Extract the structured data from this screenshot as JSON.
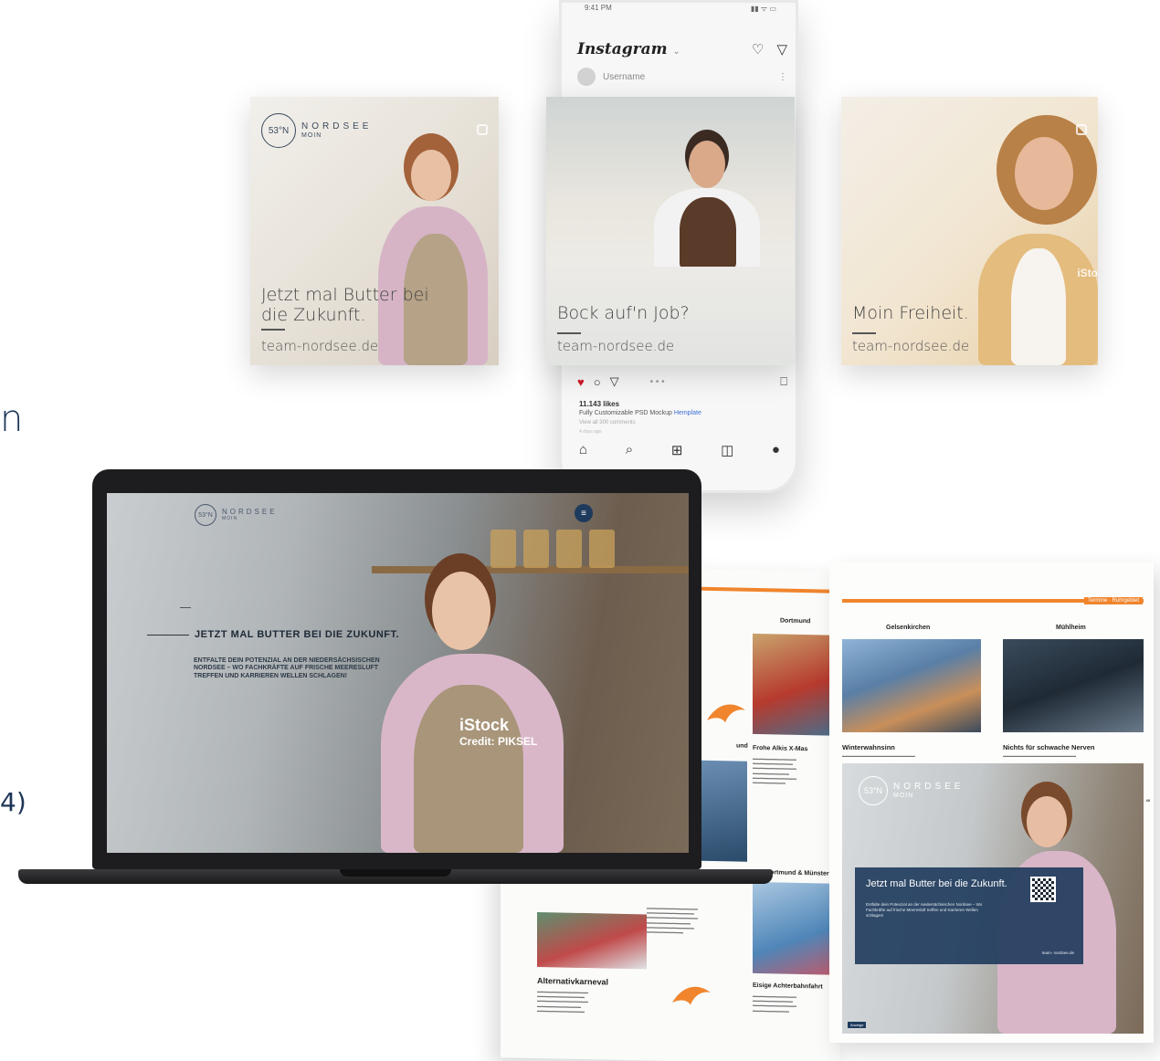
{
  "edge": {
    "n": "n",
    "four": "4)"
  },
  "phone": {
    "status_time": "9:41 PM",
    "status_icons": "▮▮ ᯤ ▭",
    "app_name": "Instagram",
    "username": "Username",
    "likes": "11.143 likes",
    "caption_text": "Fully Customizable PSD Mockup ",
    "caption_link": "Hemplate",
    "comments": "View all 300 comments",
    "time_ago": "4 days ago",
    "icons": {
      "heart": "heart-icon",
      "send": "send-icon",
      "like": "heart-filled-icon",
      "comment": "comment-icon",
      "bookmark": "bookmark-icon",
      "home": "home-icon",
      "search": "search-icon",
      "add": "add-icon",
      "shop": "shop-icon",
      "profile": "profile-icon"
    }
  },
  "brand": {
    "circle": "53°N",
    "word1": "NORDSEE",
    "word2": "MOIN"
  },
  "tiles": [
    {
      "headline_1": "Jetzt mal Butter bei",
      "headline_2": "die Zukunft.",
      "url": "team-nordsee.de"
    },
    {
      "headline_1": "Bock auf'n Job?",
      "url": "team-nordsee.de"
    },
    {
      "headline_1": "Moin Freiheit.",
      "url": "team-nordsee.de",
      "side_text": "iSto"
    }
  ],
  "website": {
    "headline": "JETZT MAL BUTTER BEI DIE ZUKUNFT.",
    "subline": "ENTFALTE DEIN POTENZIAL AN DER NIEDERSÄCHSISCHEN NORDSEE – WO FACHKRÄFTE AUF FRISCHE MEERESLUFT TREFFEN UND KARRIEREN WELLEN SCHLAGEN!",
    "menu_icon": "≡",
    "istock": "iStock",
    "credit": "Credit: PIKSEL"
  },
  "magazine": {
    "left": {
      "city_1": "Dortmund",
      "fragment": "und",
      "heading_1": "Frohe Alkis X-Mas",
      "city_2": "Dortmund & Münster",
      "heading_2": "Alternativkarneval",
      "heading_3": "Eisige Achterbahnfahrt"
    },
    "right": {
      "tag": "Termine · Ruhrgebiet",
      "city_1": "Gelsenkirchen",
      "city_2": "Mühlheim",
      "heading_1": "Winterwahnsinn",
      "heading_2": "Nichts für schwache Nerven",
      "page_number": "49",
      "ad_title": "Jetzt mal Butter bei die Zukunft.",
      "ad_copy": "Entfalte dein Potenzial an der niedersächsischen Nordsee – Wo Fachkräfte auf frische Meeresluft treffen und Karrieren Wellen schlagen!",
      "ad_url": "team- nordsee.de",
      "ad_corner": "Anzeige"
    }
  }
}
